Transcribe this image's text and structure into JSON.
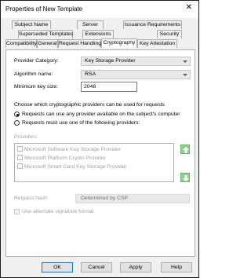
{
  "window": {
    "title": "Properties of New Template",
    "close_glyph": "✕"
  },
  "tabs": {
    "row1": [
      "Subject Name",
      "Server",
      "Issuance Requirements"
    ],
    "row2": [
      "Superseded Templates",
      "Extensions",
      "Security"
    ],
    "row3": [
      "Compatibility",
      "General",
      "Request Handling",
      "Cryptography",
      "Key Attestation"
    ],
    "active": "Cryptography"
  },
  "crypto": {
    "provider_category_label": "Provider Category:",
    "provider_category_value": "Key Storage Provider",
    "algorithm_label": "Algorithm name:",
    "algorithm_value": "RSA",
    "min_key_label": "Minimum key size:",
    "min_key_value": "2048",
    "choose_text": "Choose which cryptographic providers can be used for requests",
    "radio_any": "Requests can use any provider available on the subject's computer",
    "radio_any_selected": true,
    "radio_one": "Requests must use one of the following providers:",
    "providers_label": "Providers:",
    "providers": [
      "Microsoft Software Key Storage Provider",
      "Microsoft Platform Crypto Provider",
      "Microsoft Smart Card Key Storage Provider"
    ],
    "request_hash_label": "Request hash:",
    "request_hash_value": "Determined by CSP",
    "alt_sig_label": "Use alternate signature format"
  },
  "buttons": {
    "ok": "OK",
    "cancel": "Cancel",
    "apply": "Apply",
    "help": "Help"
  },
  "icons": {
    "up": "arrow-up-icon",
    "down": "arrow-down-icon",
    "accent": "#6ab66a"
  }
}
